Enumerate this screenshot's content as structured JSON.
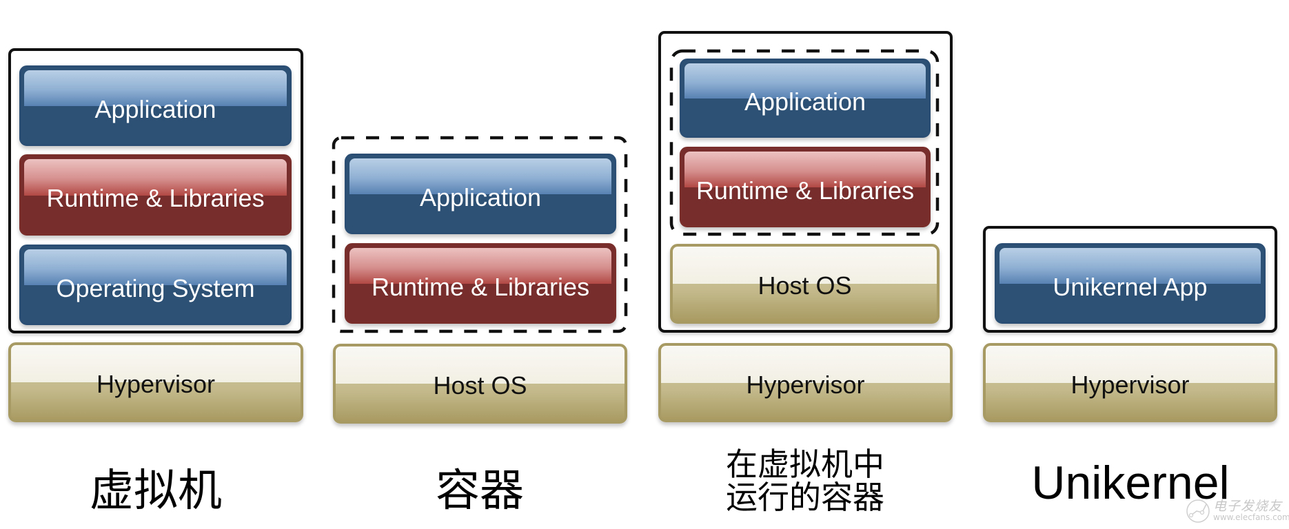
{
  "columns": [
    {
      "caption": "虚拟机",
      "layers": [
        "Application",
        "Runtime & Libraries",
        "Operating System"
      ],
      "base": "Hypervisor"
    },
    {
      "caption": "容器",
      "layers": [
        "Application",
        "Runtime & Libraries"
      ],
      "base": "Host OS"
    },
    {
      "caption_lines": [
        "在虚拟机中",
        "运行的容器"
      ],
      "layers": [
        "Application",
        "Runtime & Libraries",
        "Host OS"
      ],
      "base": "Hypervisor"
    },
    {
      "caption": "Unikernel",
      "layers": [
        "Unikernel App"
      ],
      "base": "Hypervisor"
    }
  ],
  "watermark": {
    "name": "电子发烧友",
    "url": "www.elecfans.com"
  },
  "colors": {
    "application_blue": "#2d5175",
    "runtime_red": "#762d2b",
    "base_beige": "#c3b98b",
    "boundary": "#111111"
  }
}
